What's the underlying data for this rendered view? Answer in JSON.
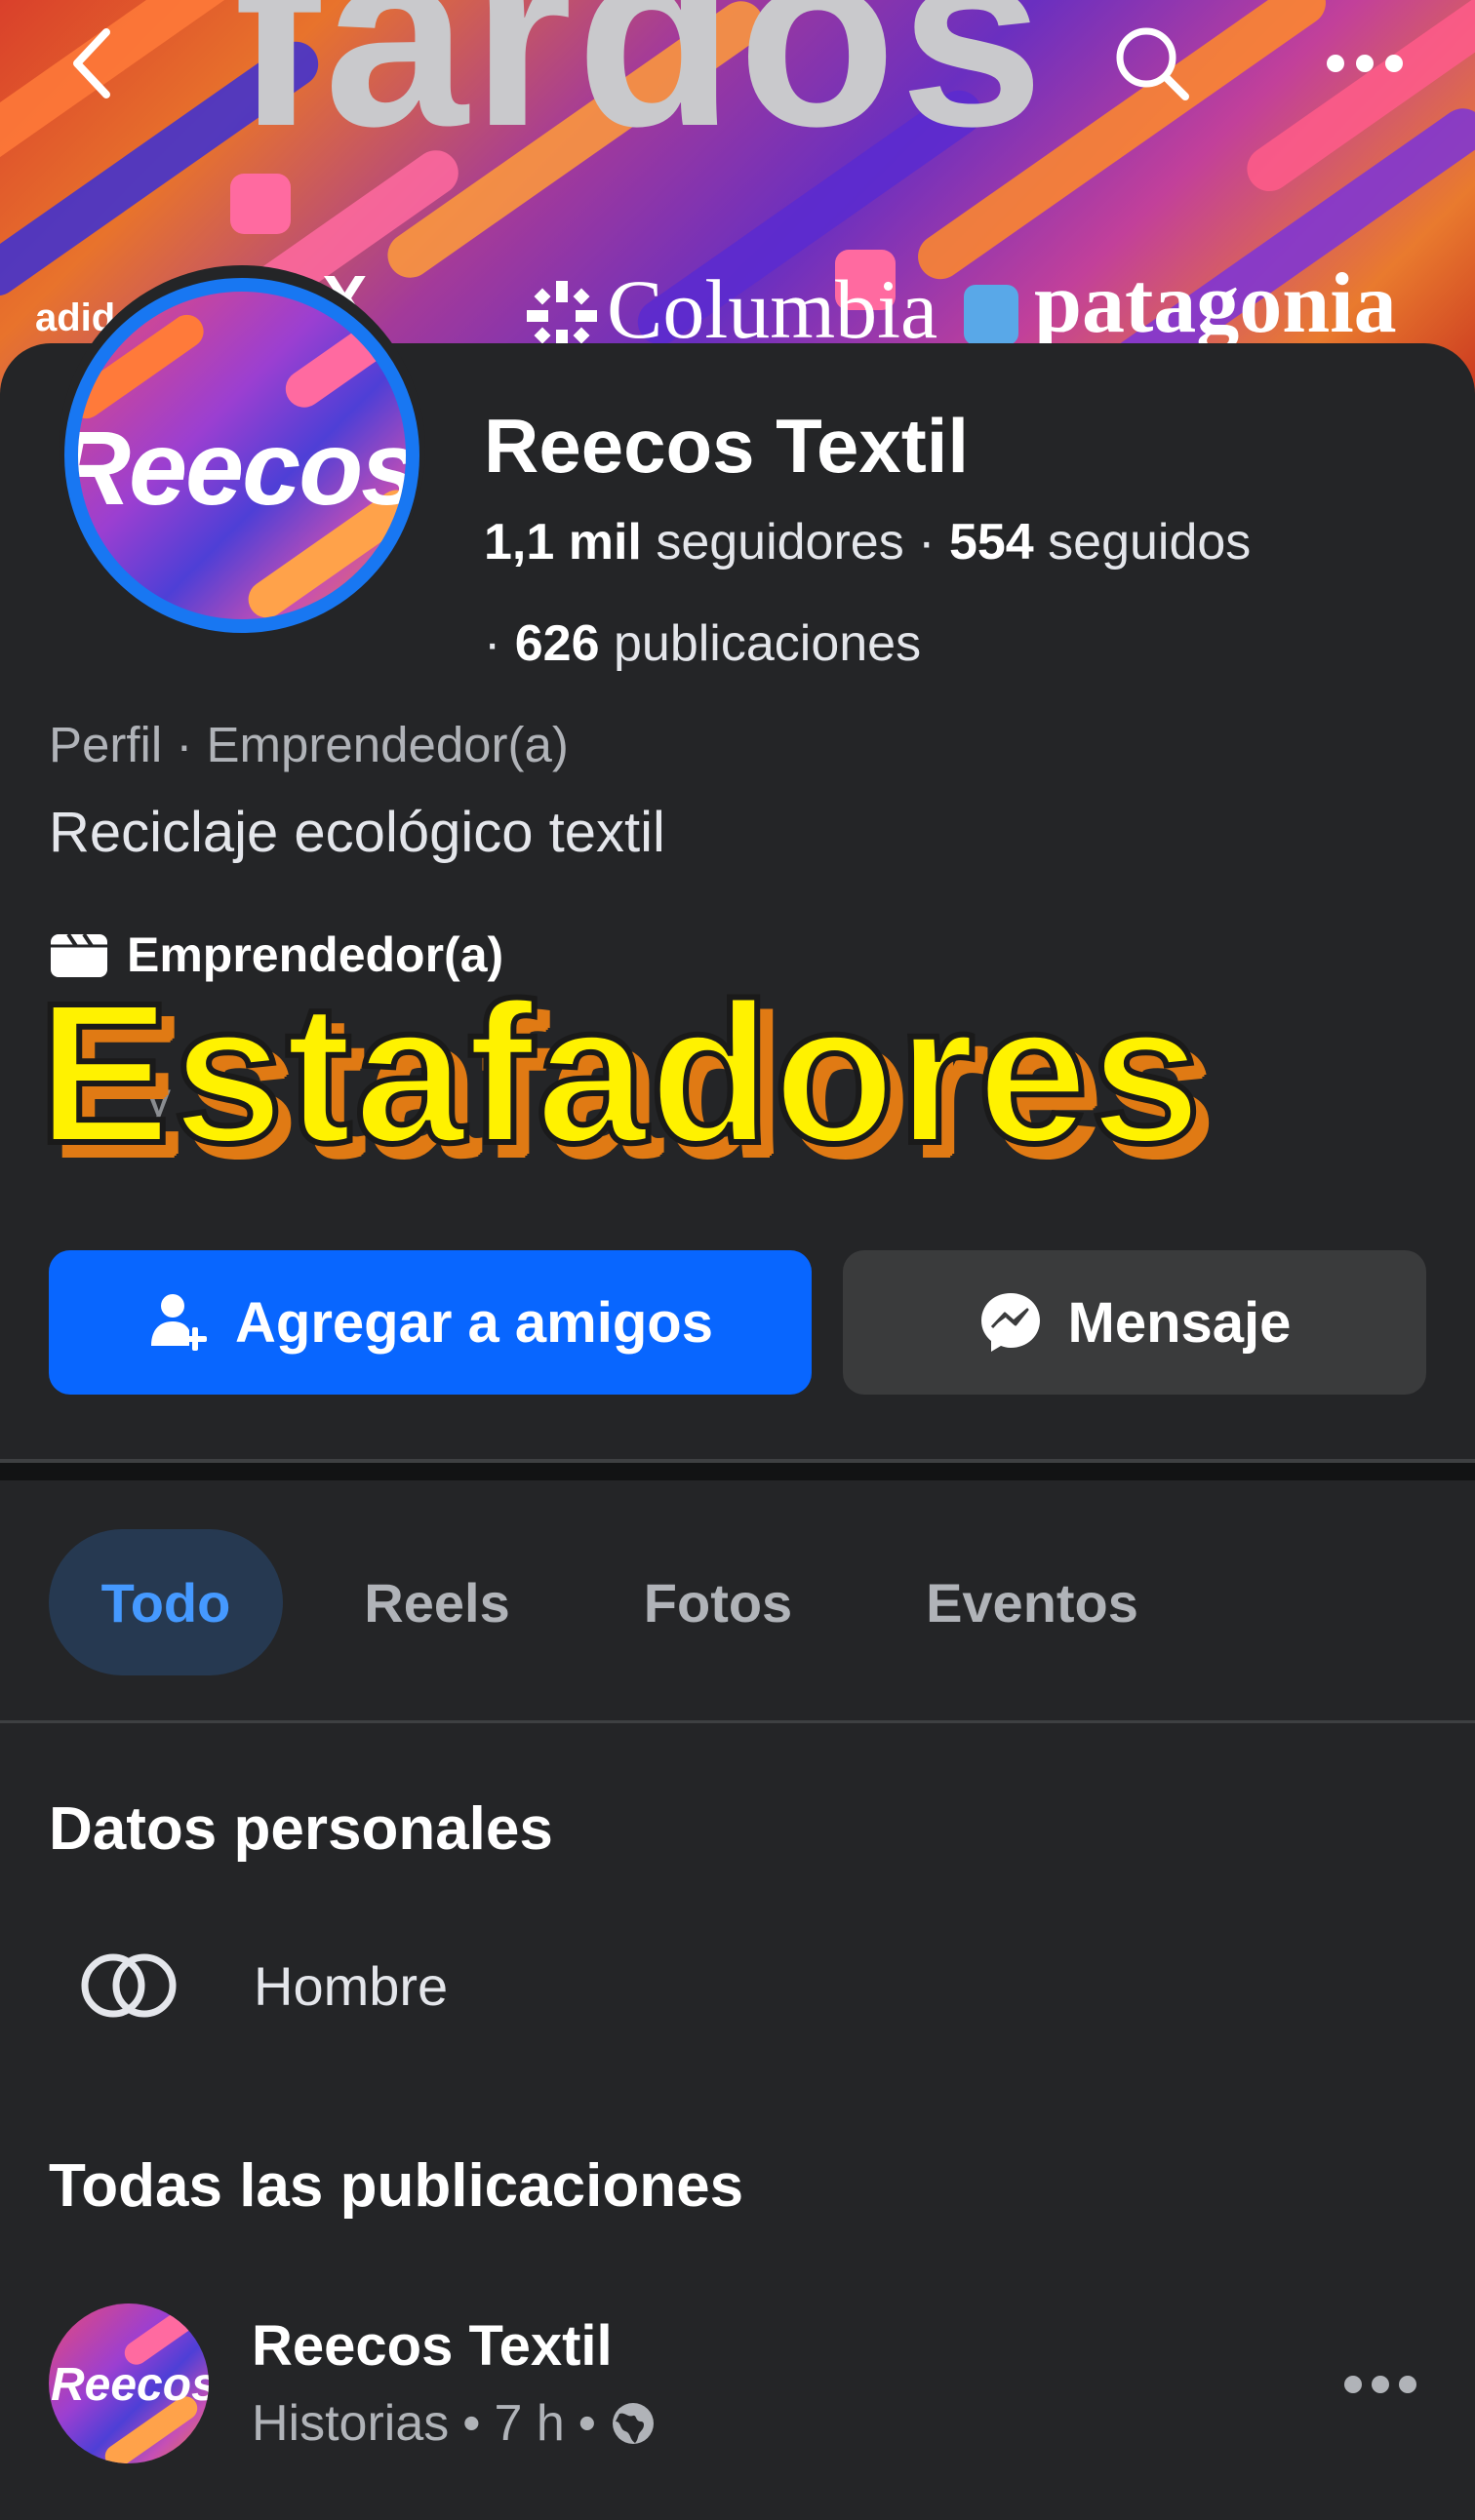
{
  "cover": {
    "title": "fardos",
    "brands": [
      "adid",
      "X",
      "Columbia",
      "patagonia"
    ]
  },
  "header": {
    "back_icon": "chevron-left-icon",
    "search_icon": "search-icon",
    "more_icon": "more-horizontal-icon"
  },
  "profile": {
    "avatar_text": "Reecos",
    "name": "Reecos Textil",
    "followers_value": "1,1 mil",
    "followers_label": " seguidores",
    "separator": " · ",
    "following_value": "554",
    "following_label": " seguidos",
    "posts_prefix": "· ",
    "posts_value": "626",
    "posts_label": " publicaciones",
    "category": "Perfil · Emprendedor(a)",
    "bio": "Reciclaje ecológico textil",
    "detail_label": "Emprendedor(a)",
    "hidden_row_fragment": "y"
  },
  "overlay_text": "Estafadores",
  "actions": {
    "add_friend": "Agregar a amigos",
    "message": "Mensaje"
  },
  "tabs": [
    {
      "label": "Todo",
      "active": true
    },
    {
      "label": "Reels",
      "active": false
    },
    {
      "label": "Fotos",
      "active": false
    },
    {
      "label": "Eventos",
      "active": false
    }
  ],
  "personal": {
    "title": "Datos personales",
    "gender": "Hombre"
  },
  "posts": {
    "title": "Todas las publicaciones",
    "first": {
      "avatar_text": "Reecos",
      "author": "Reecos Textil",
      "source": "Historias",
      "time": "7 h",
      "audience_icon": "globe-icon"
    }
  },
  "colors": {
    "background": "#242527",
    "accent_blue": "#0866ff",
    "overlay_yellow": "#fff200",
    "overlay_shadow": "#e07a14"
  }
}
